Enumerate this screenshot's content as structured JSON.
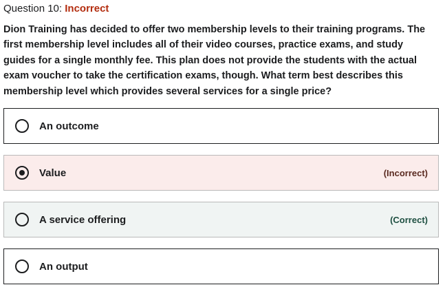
{
  "question": {
    "number_label": "Question 10:",
    "status": "Incorrect",
    "text": "Dion Training has decided to offer two membership levels to their training programs. The first membership level includes all of their video courses, practice exams, and study guides for a single monthly fee. This plan does not provide the students with the actual exam voucher to take the certification exams, though. What term best describes this membership level which provides several services for a single price?"
  },
  "options": [
    {
      "label": "An outcome",
      "selected": false,
      "result": ""
    },
    {
      "label": "Value",
      "selected": true,
      "result": "(Incorrect)"
    },
    {
      "label": "A service offering",
      "selected": false,
      "result": "(Correct)"
    },
    {
      "label": "An output",
      "selected": false,
      "result": ""
    }
  ],
  "colors": {
    "incorrect_text": "#b32d0f",
    "incorrect_bg": "#fbeceb",
    "correct_bg": "#f0f4f3"
  }
}
